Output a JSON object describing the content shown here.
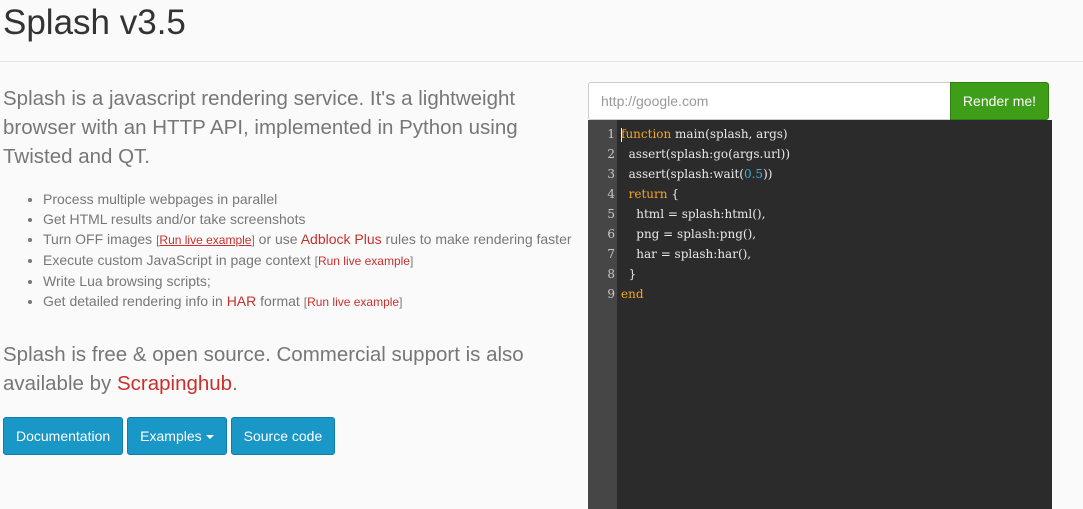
{
  "header": {
    "title": "Splash v3.5"
  },
  "intro": {
    "text": "Splash is a javascript rendering service. It's a lightweight browser with an HTTP API, implemented in Python using Twisted and QT."
  },
  "features": {
    "item1": "Process multiple webpages in parallel",
    "item2": "Get HTML results and/or take screenshots",
    "item3_a": "Turn OFF images ",
    "item3_open": "[",
    "item3_link": "Run live example",
    "item3_close": "]",
    "item3_b": " or use ",
    "item3_adblock": "Adblock Plus",
    "item3_c": " rules to make rendering faster",
    "item4_a": "Execute custom JavaScript in page context ",
    "item4_open": "[",
    "item4_link": "Run live example",
    "item4_close": "]",
    "item5": "Write Lua browsing scripts;",
    "item6_a": "Get detailed rendering info in ",
    "item6_har": "HAR",
    "item6_b": " format ",
    "item6_open": "[",
    "item6_link": "Run live example",
    "item6_close": "]"
  },
  "support": {
    "text": "Splash is free & open source. Commercial support is also available by ",
    "link": "Scrapinghub",
    "end": "."
  },
  "buttons": {
    "documentation": "Documentation",
    "examples": "Examples",
    "source": "Source code"
  },
  "render_form": {
    "url_placeholder": "http://google.com",
    "url_value": "",
    "render_label": "Render me!"
  },
  "editor": {
    "line_numbers": [
      "1",
      "2",
      "3",
      "4",
      "5",
      "6",
      "7",
      "8",
      "9"
    ],
    "l1_kw": "function",
    "l1_rest": " main(splash, args)",
    "l2": "  assert(splash:go(args.url))",
    "l3_a": "  assert(splash:wait(",
    "l3_num": "0.5",
    "l3_b": "))",
    "l4_indent": "  ",
    "l4_kw": "return",
    "l4_rest": " {",
    "l5": "    html = splash:html(),",
    "l6": "    png = splash:png(),",
    "l7": "    har = splash:har(),",
    "l8": "  }",
    "l9_kw": "end"
  },
  "colors": {
    "accent_blue": "#1997c6",
    "render_green": "#3f9e18",
    "link_red": "#c9302c",
    "keyword_orange": "#f5a623",
    "number_blue": "#3ab0d9"
  }
}
